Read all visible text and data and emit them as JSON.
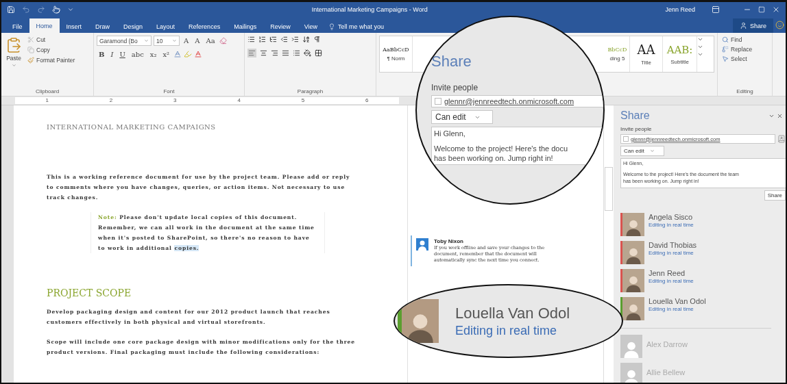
{
  "title_bar": {
    "title": "International Marketing Campaigns - Word",
    "user": "Jenn Reed"
  },
  "tabs": [
    {
      "label": "File",
      "selected": false
    },
    {
      "label": "Home",
      "selected": true
    },
    {
      "label": "Insert",
      "selected": false
    },
    {
      "label": "Draw",
      "selected": false
    },
    {
      "label": "Design",
      "selected": false
    },
    {
      "label": "Layout",
      "selected": false
    },
    {
      "label": "References",
      "selected": false
    },
    {
      "label": "Mailings",
      "selected": false
    },
    {
      "label": "Review",
      "selected": false
    },
    {
      "label": "View",
      "selected": false
    }
  ],
  "tell_me": "Tell me what you",
  "share_button": "Share",
  "ribbon": {
    "clipboard": {
      "paste": "Paste",
      "items": [
        "Cut",
        "Copy",
        "Format Painter"
      ],
      "label": "Clipboard"
    },
    "font": {
      "name": "Garamond (Bo",
      "size": "10",
      "top_glyphs": [
        "A",
        "A",
        "Aa"
      ],
      "bottom_glyphs": [
        "B",
        "I",
        "U",
        "abc",
        "x₂",
        "x²"
      ],
      "label": "Font"
    },
    "paragraph": {
      "label": "Paragraph"
    },
    "styles": [
      {
        "preview": "AaBbCcD",
        "name": "¶ Norm",
        "kind": "plain"
      },
      {
        "preview": "BbCcD",
        "name": "ding 5",
        "kind": "heading"
      },
      {
        "preview": "AA",
        "name": "Title",
        "kind": "title"
      },
      {
        "preview": "AAB:",
        "name": "Subtitle",
        "kind": "subtitle"
      }
    ],
    "editing": {
      "items": [
        "Find",
        "Replace",
        "Select"
      ],
      "label": "Editing"
    }
  },
  "ruler": [
    "1",
    "2",
    "3",
    "4",
    "5",
    "6"
  ],
  "document": {
    "title": "INTERNATIONAL MARKETING CAMPAIGNS",
    "intro": "This is a working reference document for use by the project team. Please add or reply to comments where you have changes, queries, or action items. Not necessary to use track changes.",
    "note_label": "Note:",
    "note": "Please don't update local copies of this document. Remember, we can all work in the document at the same time when it's posted to SharePoint, so there's no reason to have to work in additional",
    "note_highlight": "copies.",
    "heading": "PROJECT SCOPE",
    "paragraphs": [
      "Develop packaging design and content for our 2012 product launch that reaches customers effectively in both physical and virtual storefronts.",
      "Scope will include one core package design with minor modifications only for the three product versions.  Final packaging must include the following considerations:"
    ]
  },
  "comment": {
    "author": "Toby Nixon",
    "text": "If you work offline and save your changes to the document, remember that the document will automatically sync the next time you connect."
  },
  "share_pane": {
    "title": "Share",
    "invite_label": "Invite people",
    "email": "glennr@jennreedtech.onmicrosoft.com",
    "permission": "Can edit",
    "message": [
      "Hi Glenn,",
      "Welcome to the project! Here's the document the team",
      "has been working on. Jump right in!"
    ],
    "button": "Share",
    "people": [
      {
        "name": "Angela Sisco",
        "status": "Editing in real time",
        "color": "#d9534f"
      },
      {
        "name": "David Thobias",
        "status": "Editing in real time",
        "color": "#d9534f"
      },
      {
        "name": "Jenn Reed",
        "status": "Editing in real time",
        "color": "#d9534f"
      },
      {
        "name": "Louella Van Odol",
        "status": "Editing in real time",
        "color": "#5a9e2f"
      }
    ],
    "others": [
      {
        "name": "Alex Darrow"
      },
      {
        "name": "Allie Bellew"
      }
    ]
  },
  "magnifier": {
    "title": "Share",
    "invite_label": "Invite people",
    "email": "glennr@jennreedtech.onmicrosoft.com",
    "permission": "Can edit",
    "message": [
      "Hi Glenn,",
      "Welcome to the project! Here's the docu",
      "has been working on. Jump right in!"
    ]
  },
  "focus": {
    "name": "Louella Van Odol",
    "status": "Editing in real time",
    "color": "#5a9e2f"
  }
}
